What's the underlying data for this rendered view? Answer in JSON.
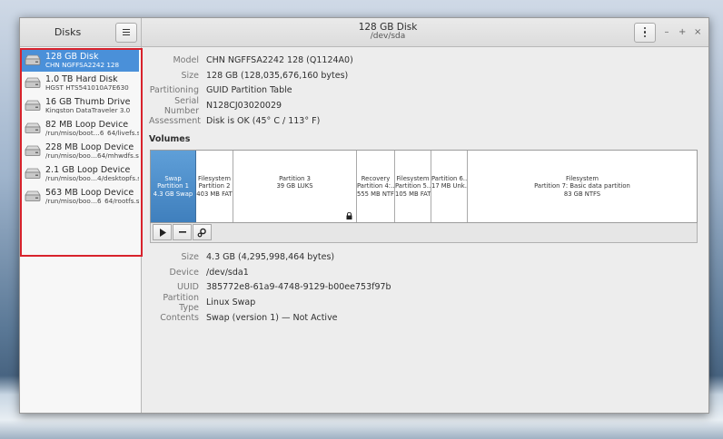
{
  "window": {
    "sidebar_title": "Disks",
    "title": "128 GB Disk",
    "subtitle": "/dev/sda"
  },
  "wm_controls": [
    "–",
    "+",
    "×"
  ],
  "devices": [
    {
      "name": "128 GB Disk",
      "sub": "CHN NGFFSA2242 128",
      "selected": true
    },
    {
      "name": "1.0 TB Hard Disk",
      "sub": "HGST HTS541010A7E630",
      "selected": false
    },
    {
      "name": "16 GB Thumb Drive",
      "sub": "Kingston DataTraveler 3.0",
      "selected": false
    },
    {
      "name": "82 MB Loop Device",
      "sub": "/run/miso/boot…6_64/livefs.sfs",
      "selected": false
    },
    {
      "name": "228 MB Loop Device",
      "sub": "/run/miso/boo…64/mhwdfs.sfs",
      "selected": false
    },
    {
      "name": "2.1 GB Loop Device",
      "sub": "/run/miso/boo…4/desktopfs.sfs",
      "selected": false
    },
    {
      "name": "563 MB Loop Device",
      "sub": "/run/miso/boo…6_64/rootfs.sfs",
      "selected": false
    }
  ],
  "disk_props": [
    {
      "label": "Model",
      "value": "CHN NGFFSA2242 128 (Q1124A0)"
    },
    {
      "label": "Size",
      "value": "128 GB (128,035,676,160 bytes)"
    },
    {
      "label": "Partitioning",
      "value": "GUID Partition Table"
    },
    {
      "label": "Serial Number",
      "value": "N128CJ03020029"
    },
    {
      "label": "Assessment",
      "value": "Disk is OK (45° C / 113° F)"
    }
  ],
  "volumes_label": "Volumes",
  "partitions": [
    {
      "l1": "Swap",
      "l2": "Partition 1",
      "l3": "4.3 GB Swap",
      "selected": true
    },
    {
      "l1": "Filesystem",
      "l2": "Partition 2",
      "l3": "403 MB FAT",
      "selected": false
    },
    {
      "l1": "",
      "l2": "Partition 3",
      "l3": "39 GB LUKS",
      "selected": false,
      "locked": true
    },
    {
      "l1": "Recovery",
      "l2": "Partition 4:…",
      "l3": "555 MB NTFS",
      "selected": false
    },
    {
      "l1": "Filesystem",
      "l2": "Partition 5…",
      "l3": "105 MB FAT",
      "selected": false
    },
    {
      "l1": "Partition 6…",
      "l2": "17 MB Unk…",
      "l3": "",
      "selected": false
    },
    {
      "l1": "Filesystem",
      "l2": "Partition 7: Basic data partition",
      "l3": "83 GB NTFS",
      "selected": false
    }
  ],
  "volume_toolbar": {
    "play_icon": "play-icon",
    "minus_icon": "minus-icon",
    "gear_icon": "gears-icon"
  },
  "volume_props": [
    {
      "label": "Size",
      "value": "4.3 GB (4,295,998,464 bytes)"
    },
    {
      "label": "Device",
      "value": "/dev/sda1"
    },
    {
      "label": "UUID",
      "value": "385772e8-61a9-4748-9129-b00ee753f97b"
    },
    {
      "label": "Partition Type",
      "value": "Linux Swap"
    },
    {
      "label": "Contents",
      "value": "Swap (version 1) — Not Active"
    }
  ],
  "colors": {
    "selection": "#4a90d9",
    "highlight_outline": "#d8222c"
  }
}
